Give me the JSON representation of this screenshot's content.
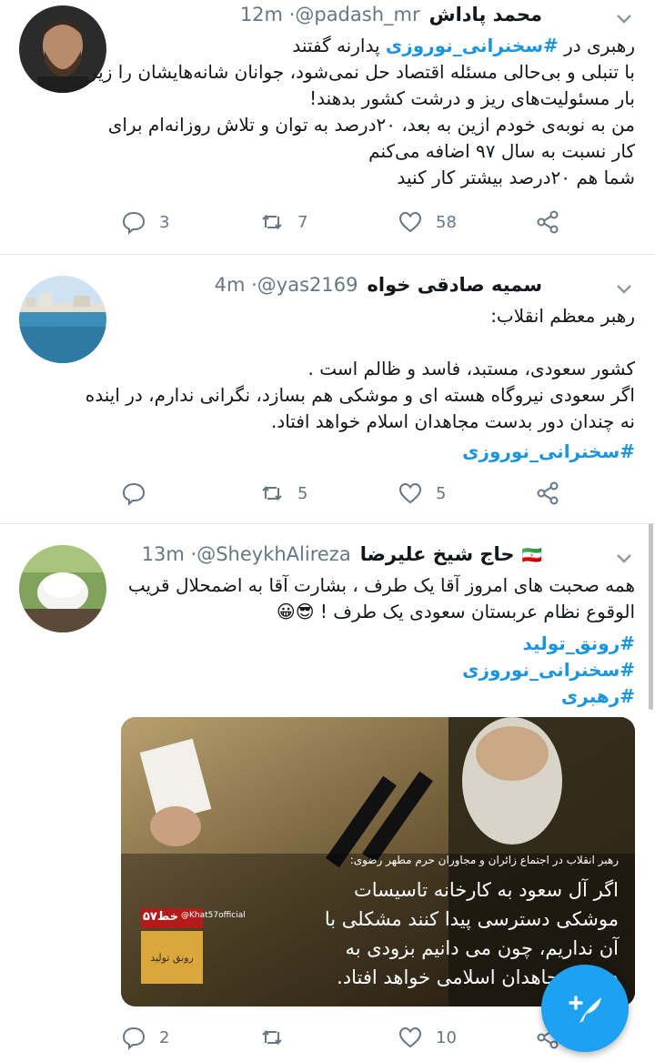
{
  "tweets": [
    {
      "name": "محمد پاداش",
      "handle": "@padash_mr",
      "time": "· 12m",
      "lines": [
        "رهبری در #سخنرانی_نوروزی پدارنه گفتند",
        "با تنبلی و بی‌حالی مسئله اقتصاد حل نمی‌شود، جوانان شانه‌هایشان را زیر",
        "بار مسئولیت‌های ریز و درشت کشور بدهند!",
        "من به نوبه‌ی خودم ازین به بعد، ۲۰درصد به توان و تلاش روزانه‌ام برای",
        "کار نسبت به سال ۹۷ اضافه می‌کنم",
        "شما هم ۲۰درصد بیشتر کار کنید"
      ],
      "line1_prefix": "رهبری در ",
      "line1_hashtag": "#سخنرانی_نوروزی",
      "line1_suffix": " پدارنه گفتند",
      "actions": {
        "reply": "3",
        "retweet": "7",
        "like": "58"
      },
      "avatar_icon": "user-photo"
    },
    {
      "name": "سمیه صادقی خواه",
      "handle": "@yas2169",
      "time": "· 4m",
      "lines": [
        "رهبر معظم انقلاب:",
        "",
        "کشور سعودی، مستبد، فاسد و ظالم است .",
        "اگر سعودی نیروگاه هسته ای و موشکی هم بسازد، نگرانی ندارم، در اینده",
        "نه چندان دور بدست مجاهدان اسلام خواهد افتاد."
      ],
      "hashtags": [
        "#سخنرانی_نوروزی"
      ],
      "actions": {
        "reply": "",
        "retweet": "5",
        "like": "5"
      },
      "avatar_icon": "sea-photo"
    },
    {
      "name": "حاج شیخ علیرضا",
      "flag": "🇮🇷",
      "handle": "@SheykhAlireza",
      "time": "· 13m",
      "lines": [
        "همه صحبت های امروز آقا یک طرف ، بشارت آقا به اضمحلال قریب",
        "الوقوع نظام عربستان سعودی یک طرف ! 😎😀"
      ],
      "hashtags": [
        "#رونق_تولید",
        "#سخنرانی_نوروزی",
        "#رهبری"
      ],
      "media": {
        "caption_small": "رهبر انقلاب در اجتماع زائران و مجاوران حرم مطهر رضوی:",
        "caption_lines": [
          "اگر آل سعود به کارخانه تاسیسات",
          "موشکی دسترسی پیدا کنند مشکلی با",
          "آن نداریم، چون می دانیم بزودی به",
          "دست مجاهدان اسلامی خواهد افتاد."
        ],
        "watermark": "@Khat57official",
        "logo": "خط۵۷",
        "badge": "رونق تولید"
      },
      "actions": {
        "reply": "2",
        "retweet": "",
        "like": "10"
      },
      "avatar_icon": "turban-photo"
    }
  ],
  "icons": {
    "reply": "reply-icon",
    "retweet": "retweet-icon",
    "like": "like-icon",
    "share": "share-icon",
    "more": "chevron-down-icon",
    "compose": "compose-tweet-icon"
  },
  "colors": {
    "accent": "#1da1f2",
    "hashtag": "#1b95e0",
    "muted": "#657786"
  }
}
